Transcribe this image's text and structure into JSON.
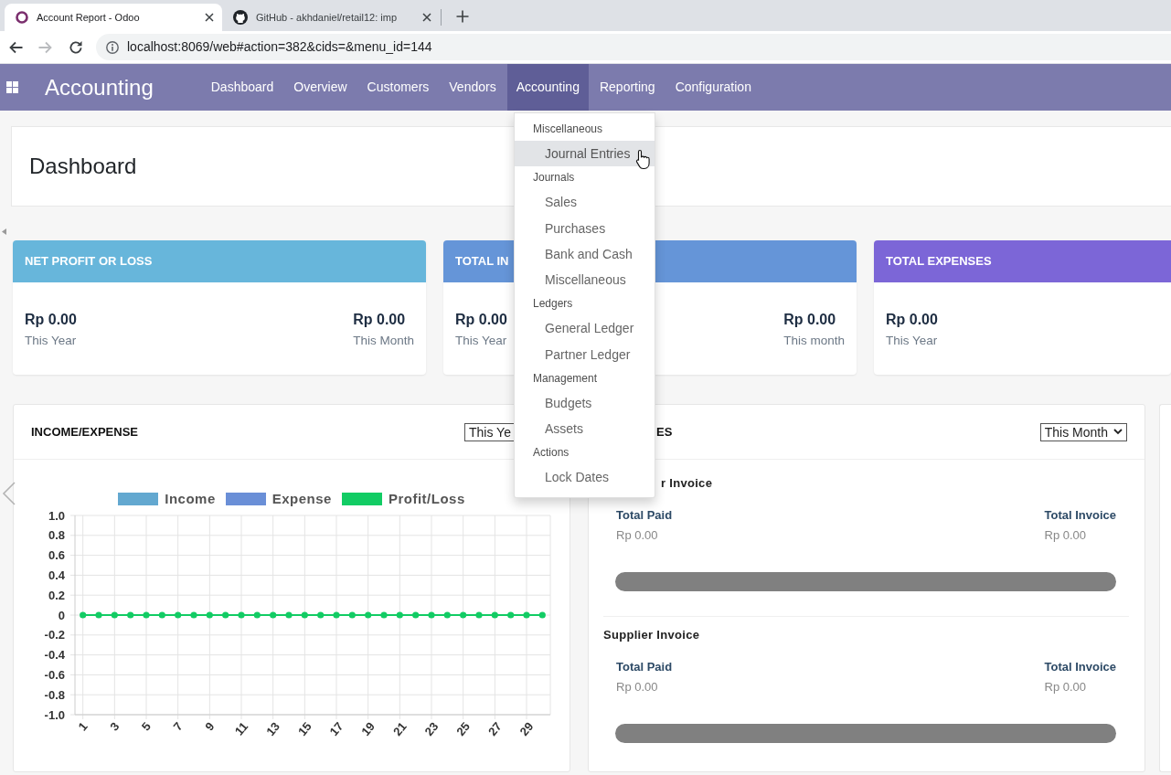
{
  "browser": {
    "tabs": [
      {
        "title": "Account Report - Odoo",
        "selected": true
      },
      {
        "title": "GitHub - akhdaniel/retail12: imp",
        "selected": false
      }
    ],
    "forward_disabled": true,
    "url": "localhost:8069/web#action=382&cids=&menu_id=144"
  },
  "navbar": {
    "brand": "Accounting",
    "items": [
      {
        "label": "Dashboard",
        "selected": false
      },
      {
        "label": "Overview",
        "selected": false
      },
      {
        "label": "Customers",
        "selected": false
      },
      {
        "label": "Vendors",
        "selected": false
      },
      {
        "label": "Accounting",
        "selected": true
      },
      {
        "label": "Reporting",
        "selected": false
      },
      {
        "label": "Configuration",
        "selected": false
      }
    ]
  },
  "dropdown": {
    "sections": [
      {
        "header": "Miscellaneous",
        "items": [
          {
            "label": "Journal Entries",
            "highlighted": true
          }
        ]
      },
      {
        "header": "Journals",
        "items": [
          {
            "label": "Sales",
            "highlighted": false
          },
          {
            "label": "Purchases",
            "highlighted": false
          },
          {
            "label": "Bank and Cash",
            "highlighted": false
          },
          {
            "label": "Miscellaneous",
            "highlighted": false
          }
        ]
      },
      {
        "header": "Ledgers",
        "items": [
          {
            "label": "General Ledger",
            "highlighted": false
          },
          {
            "label": "Partner Ledger",
            "highlighted": false
          }
        ]
      },
      {
        "header": "Management",
        "items": [
          {
            "label": "Budgets",
            "highlighted": false
          },
          {
            "label": "Assets",
            "highlighted": false
          }
        ]
      },
      {
        "header": "Actions",
        "items": [
          {
            "label": "Lock Dates",
            "highlighted": false
          }
        ]
      }
    ]
  },
  "control_panel": {
    "title": "Dashboard"
  },
  "summary_cards": [
    {
      "title": "NET PROFIT OR LOSS",
      "color": "#67b6db",
      "left": {
        "amount": "Rp 0.00",
        "period": "This Year"
      },
      "right": {
        "amount": "Rp 0.00",
        "period": "This Month"
      }
    },
    {
      "title": "TOTAL IN",
      "color": "#6595d8",
      "left": {
        "amount": "Rp 0.00",
        "period": "This Year"
      },
      "right": {
        "amount": "Rp 0.00",
        "period": "This month"
      }
    },
    {
      "title": "TOTAL EXPENSES",
      "color": "#7c66d7",
      "left": {
        "amount": "Rp 0.00",
        "period": "This Year"
      }
    }
  ],
  "income_expense": {
    "title": "INCOME/EXPENSE",
    "filter": "This Ye",
    "chart_data": {
      "type": "line",
      "x": [
        1,
        2,
        3,
        4,
        5,
        6,
        7,
        8,
        9,
        10,
        11,
        12,
        13,
        14,
        15,
        16,
        17,
        18,
        19,
        20,
        21,
        22,
        23,
        24,
        25,
        26,
        27,
        28,
        29,
        30
      ],
      "xlim": [
        0.5,
        30.5
      ],
      "xticks": [
        1,
        3,
        5,
        7,
        9,
        11,
        13,
        15,
        17,
        19,
        21,
        23,
        25,
        27,
        29
      ],
      "series": [
        {
          "name": "Income",
          "color": "#63a8d0",
          "values": [
            null,
            null,
            null,
            null,
            null,
            null,
            null,
            null,
            null,
            null,
            null,
            null,
            null,
            null,
            null,
            null,
            null,
            null,
            null,
            null,
            null,
            null,
            null,
            null,
            null,
            null,
            null,
            null,
            null,
            null
          ]
        },
        {
          "name": "Expense",
          "color": "#6a8fd7",
          "values": [
            null,
            null,
            null,
            null,
            null,
            null,
            null,
            null,
            null,
            null,
            null,
            null,
            null,
            null,
            null,
            null,
            null,
            null,
            null,
            null,
            null,
            null,
            null,
            null,
            null,
            null,
            null,
            null,
            null,
            null
          ]
        },
        {
          "name": "Profit/Loss",
          "color": "#12cc64",
          "values": [
            0,
            0,
            0,
            0,
            0,
            0,
            0,
            0,
            0,
            0,
            0,
            0,
            0,
            0,
            0,
            0,
            0,
            0,
            0,
            0,
            0,
            0,
            0,
            0,
            0,
            0,
            0,
            0,
            0,
            0
          ]
        }
      ],
      "ylim": [
        -1,
        1
      ],
      "yticks": [
        {
          "value": 1,
          "label": "1.0"
        },
        0.8,
        0.6,
        0.4,
        0.2,
        0,
        -0.2,
        -0.4,
        -0.6,
        -0.8,
        {
          "value": -1,
          "label": "-1.0"
        }
      ],
      "grid": true,
      "legend": "top",
      "marker": "circle"
    }
  },
  "invoices": {
    "title": "ES",
    "filter": "This Month",
    "sections": [
      {
        "title": "r Invoice",
        "paid_label": "Total Paid",
        "paid": "Rp 0.00",
        "invoice_label": "Total Invoice",
        "invoice": "Rp 0.00",
        "level": 0
      },
      {
        "title": "Supplier Invoice",
        "paid_label": "Total Paid",
        "paid": "Rp 0.00",
        "invoice_label": "Total Invoice",
        "invoice": "Rp 0.00",
        "level": 0
      }
    ]
  }
}
